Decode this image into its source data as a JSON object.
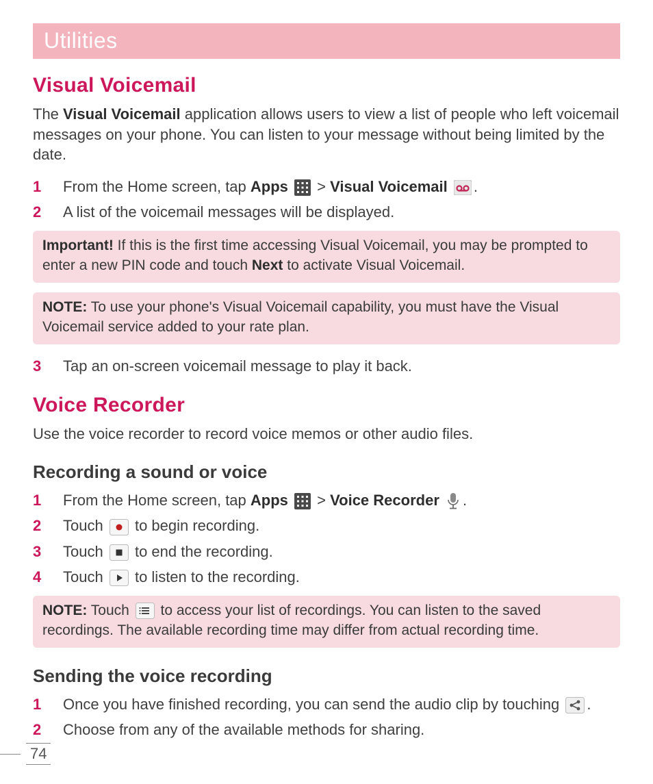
{
  "banner": {
    "title": "Utilities"
  },
  "visualVoicemail": {
    "heading": "Visual Voicemail",
    "intro_pre": "The ",
    "intro_bold": "Visual Voicemail",
    "intro_post": " application allows users to view a list of people who left voicemail messages on your phone. You can listen to your message without being limited by the date.",
    "step1": {
      "num": "1",
      "pre": "From the Home screen, tap ",
      "apps": "Apps",
      "sep": " > ",
      "vv": "Visual Voicemail",
      "post": "."
    },
    "step2": {
      "num": "2",
      "text": "A list of the voicemail messages will be displayed."
    },
    "importantBox": {
      "label": "Important!",
      "pre": " If this is the first time accessing Visual Voicemail, you may be prompted to enter a new PIN code and touch ",
      "next": "Next",
      "post": " to activate Visual Voicemail."
    },
    "noteBox": {
      "label": "NOTE:",
      "text": " To use your phone's Visual Voicemail capability, you must have the Visual Voicemail service added to your rate plan."
    },
    "step3": {
      "num": "3",
      "text": "Tap an on-screen voicemail message to play it back."
    }
  },
  "voiceRecorder": {
    "heading": "Voice Recorder",
    "intro": "Use the voice recorder to record voice memos or other audio files.",
    "recording": {
      "heading": "Recording a sound or voice",
      "step1": {
        "num": "1",
        "pre": "From the Home screen, tap ",
        "apps": "Apps",
        "sep": " > ",
        "vr": "Voice Recorder",
        "post": "."
      },
      "step2": {
        "num": "2",
        "pre": "Touch ",
        "post": " to begin recording."
      },
      "step3": {
        "num": "3",
        "pre": "Touch ",
        "post": " to end the recording."
      },
      "step4": {
        "num": "4",
        "pre": "Touch ",
        "post": " to listen to the recording."
      },
      "noteBox": {
        "label": "NOTE:",
        "pre": " Touch ",
        "post": " to access your list of recordings. You can listen to the saved recordings. The available recording time may differ from actual recording time."
      }
    },
    "sending": {
      "heading": "Sending the voice recording",
      "step1": {
        "num": "1",
        "pre": "Once you have finished recording, you can send the audio clip by touching ",
        "post": "."
      },
      "step2": {
        "num": "2",
        "text": "Choose from any of the available methods for sharing."
      }
    }
  },
  "pageNumber": "74"
}
